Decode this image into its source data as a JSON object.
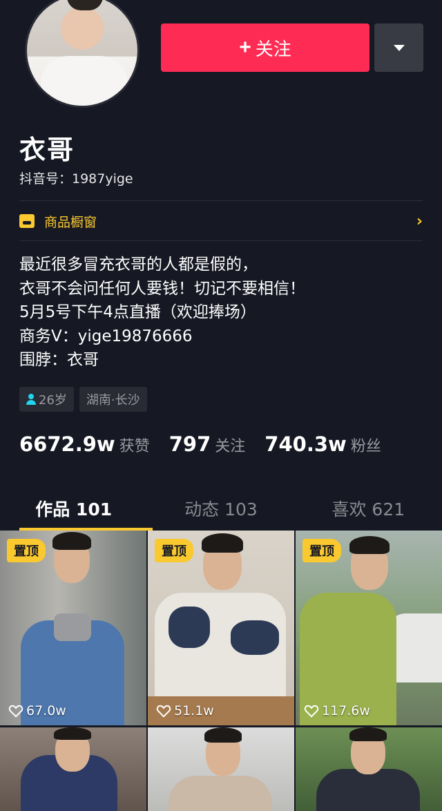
{
  "header": {
    "follow_label": "关注"
  },
  "profile": {
    "name": "衣哥",
    "douyin_id": "抖音号：1987yige"
  },
  "shop": {
    "label": "商品橱窗"
  },
  "bio": {
    "lines": [
      "最近很多冒充衣哥的人都是假的，",
      "衣哥不会问任何人要钱！切记不要相信！",
      "5月5号下午4点直播（欢迎捧场）",
      "商务V：yige19876666",
      "围脖：衣哥"
    ]
  },
  "tags": {
    "age": "26岁",
    "location": "湖南·长沙"
  },
  "stats": [
    {
      "num": "6672.9w",
      "label": "获赞"
    },
    {
      "num": "797",
      "label": "关注"
    },
    {
      "num": "740.3w",
      "label": "粉丝"
    }
  ],
  "tabs": [
    {
      "label": "作品 101"
    },
    {
      "label": "动态 103"
    },
    {
      "label": "喜欢 621"
    }
  ],
  "videos": [
    {
      "pin": "置顶",
      "likes": "67.0w"
    },
    {
      "pin": "置顶",
      "likes": "51.1w"
    },
    {
      "pin": "置顶",
      "likes": "117.6w"
    }
  ],
  "colors": {
    "background": "#161823",
    "accent": "#fe2c55",
    "highlight": "#fac92f"
  }
}
